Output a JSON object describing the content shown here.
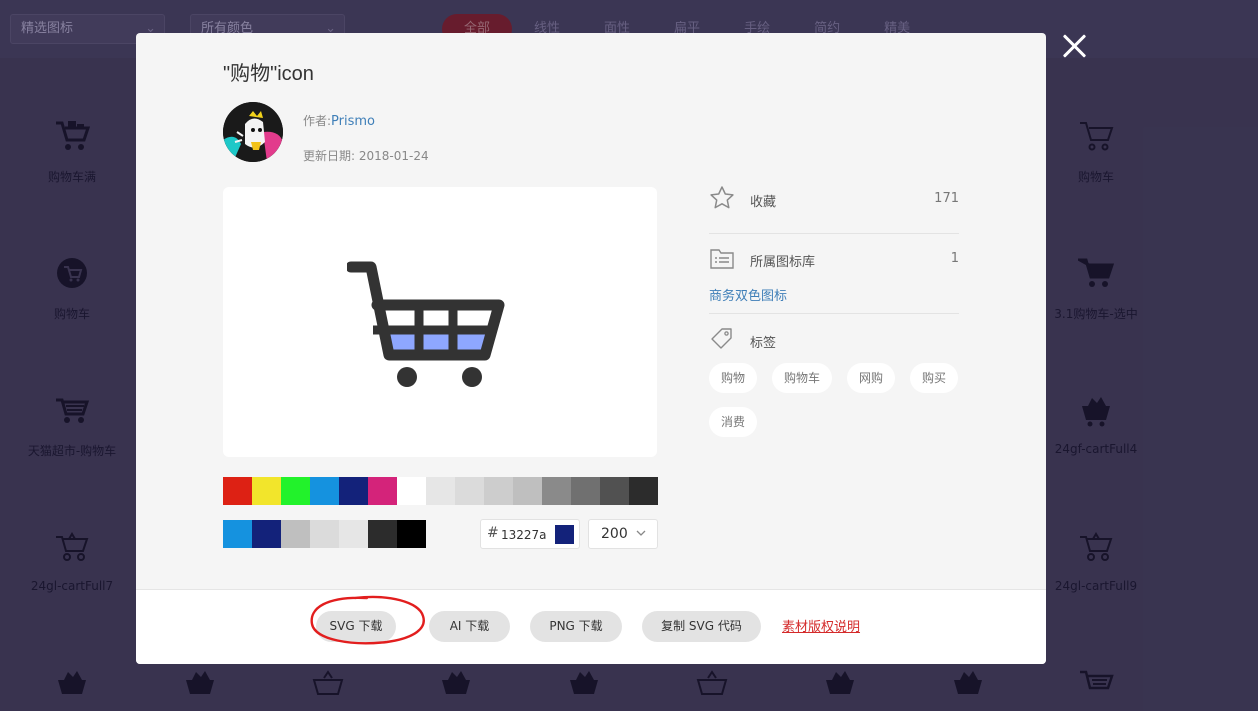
{
  "background": {
    "filter_select_1": "精选图标",
    "filter_select_2": "所有颜色",
    "tabs": [
      "全部",
      "线性",
      "面性",
      "扁平",
      "手绘",
      "简约",
      "精美"
    ],
    "left_items": [
      "购物车满",
      "购物车",
      "天猫超市-购物车",
      "24gl-cartFull7"
    ],
    "right_items": [
      "购物车",
      "3.1购物车-选中",
      "24gf-cartFull4",
      "24gl-cartFull9"
    ]
  },
  "modal": {
    "title": "\"购物\"icon",
    "author_prefix": "作者:",
    "author_name": "Prismo",
    "date_label": "更新日期: 2018-01-24",
    "color_hex": "13227a",
    "size_value": "200",
    "palette_primary": [
      "#dd2114",
      "#f2e52b",
      "#22f22b",
      "#1592df",
      "#13227a",
      "#d4237a",
      "#ffffff",
      "#e6e6e6",
      "#dbdbdb",
      "#cdcdcd",
      "#bfbfbf",
      "#8a8a8a",
      "#707070",
      "#515151",
      "#2c2c2c"
    ],
    "palette_recent": [
      "#1592df",
      "#13227a",
      "#bfbfbf",
      "#dbdbdb",
      "#e6e6e6",
      "#2c2c2c",
      "#000000"
    ],
    "icon_colors": {
      "stroke": "#333333",
      "fill": "#8ea7ff"
    },
    "collect": {
      "label": "收藏",
      "count": "171"
    },
    "library": {
      "label": "所属图标库",
      "count": "1",
      "link": "商务双色图标"
    },
    "tags_title": "标签",
    "tags": [
      "购物",
      "购物车",
      "网购",
      "购买",
      "消费"
    ],
    "downloads": {
      "svg": "SVG 下载",
      "ai": "AI 下载",
      "png": "PNG 下载",
      "copy_svg": "复制 SVG 代码"
    },
    "license": "素材版权说明"
  }
}
